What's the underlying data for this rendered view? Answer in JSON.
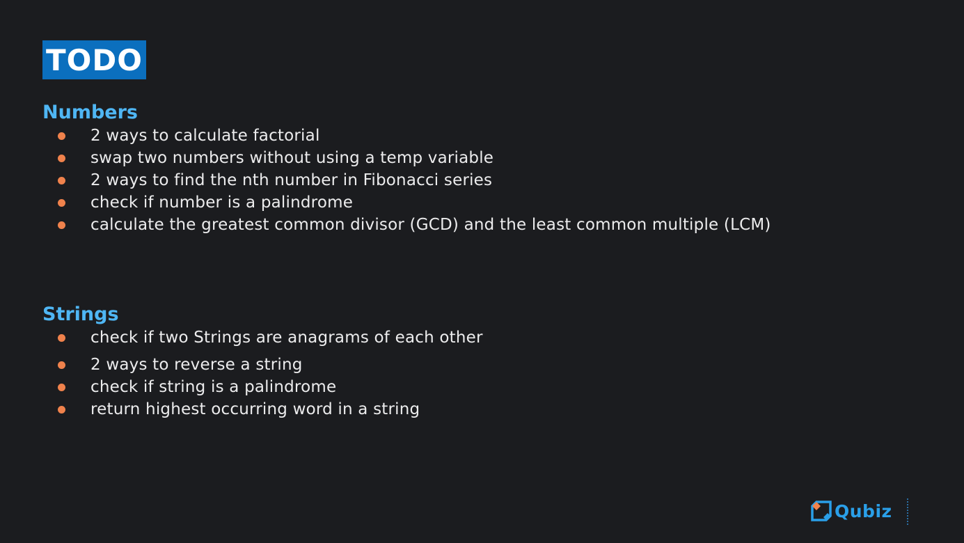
{
  "title": "TODO",
  "sections": [
    {
      "heading": "Numbers",
      "items": [
        "2 ways to calculate factorial",
        "swap two numbers without using a temp variable",
        "2 ways to find the nth number in Fibonacci series",
        "check if number is a palindrome",
        "calculate the greatest common divisor (GCD) and the least common multiple (LCM)"
      ]
    },
    {
      "heading": "Strings",
      "items": [
        "check if two Strings are anagrams of each other",
        "2 ways to reverse a string",
        "check if string is a palindrome",
        "return highest occurring word in a string"
      ]
    }
  ],
  "logo": {
    "text": "Qubiz",
    "icon": "qubiz-logo-icon"
  },
  "colors": {
    "background": "#1b1c1f",
    "title_badge": "#0b6fbe",
    "heading": "#4fb6f4",
    "bullet": "#f0824c",
    "text": "#ececed",
    "logo": "#2a9fe8"
  }
}
